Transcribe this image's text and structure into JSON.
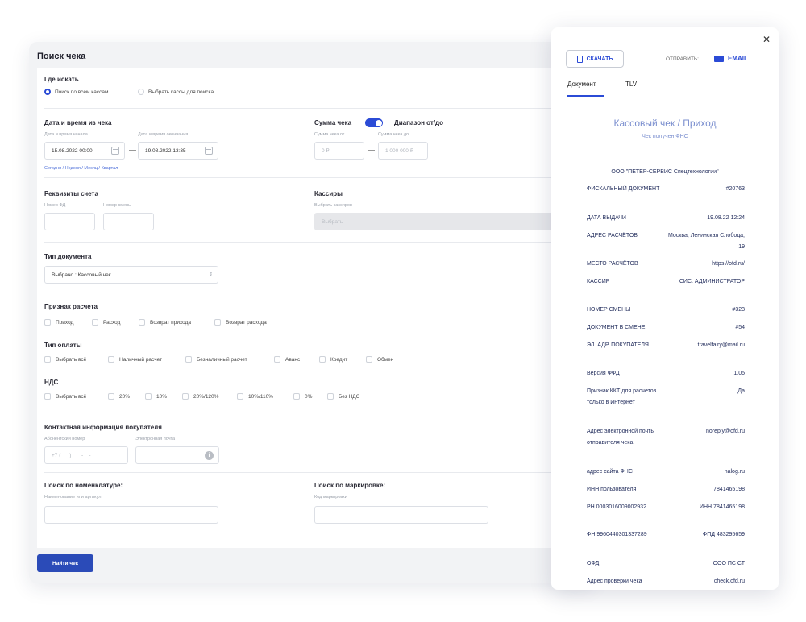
{
  "search": {
    "title": "Поиск чека",
    "where": {
      "title": "Где искать",
      "options": [
        "Поиск по всем кассам",
        "Выбрать кассы для поиска"
      ]
    },
    "datetime": {
      "title": "Дата и время из чека",
      "start_label": "Дата и время начала",
      "start_value": "15.08.2022 00:00",
      "end_label": "Дата и время окончания",
      "end_value": "19.08.2022 13:35",
      "quick_links": "Сегодня / Неделя / Месяц / Квартал"
    },
    "sum": {
      "title": "Сумма чека",
      "toggle_label": "Диапазон от/до",
      "from_label": "Сумма чека от",
      "from_value": "0 ₽",
      "to_label": "Сумма чека до",
      "to_value": "1 000 000 ₽"
    },
    "account": {
      "title": "Реквизиты счета",
      "fd_label": "Номер ФД",
      "shift_label": "Номер смены"
    },
    "cashiers": {
      "title": "Кассиры",
      "label": "Выбрать кассиров",
      "placeholder": "Выбрать"
    },
    "doc_type": {
      "title": "Тип документа",
      "value": "Выбрано : Кассовый чек"
    },
    "calc_sign": {
      "title": "Признак расчета",
      "options": [
        "Приход",
        "Расход",
        "Возврат прихода",
        "Возврат расхода"
      ]
    },
    "payment": {
      "title": "Тип оплаты",
      "options": [
        "Выбрать всё",
        "Наличный расчет",
        "Безналичный расчет",
        "Аванс",
        "Кредит",
        "Обмен"
      ]
    },
    "vat": {
      "title": "НДС",
      "options": [
        "Выбрать всё",
        "20%",
        "10%",
        "20%/120%",
        "10%/110%",
        "0%",
        "Без НДС"
      ]
    },
    "contact": {
      "title": "Контактная информация покупателя",
      "phone_label": "Абонентский номер",
      "phone_placeholder": "+7 (___) ___-__-__",
      "email_label": "Электронная почта"
    },
    "nomenclature": {
      "title": "Поиск по номенклатуре:",
      "label": "Наименование или артикул"
    },
    "marking": {
      "title": "Поиск по маркировке:",
      "label": "Код маркировки"
    },
    "find_button": "Найти чек"
  },
  "receipt": {
    "download": "СКАЧАТЬ",
    "send_label": "ОТПРАВИТЬ:",
    "email": "EMAIL",
    "tabs": [
      "Документ",
      "TLV"
    ],
    "title": "Кассовый чек / Приход",
    "subtitle": "Чек получен ФНС",
    "org": "ООО \"ПЕТЕР-СЕРВИС Спецтехнологии\"",
    "rows": [
      {
        "k": "ФИСКАЛЬНЫЙ ДОКУМЕНТ",
        "v": "#20763"
      },
      {
        "k": "ДАТА ВЫДАЧИ",
        "v": "19.08.22 12:24"
      },
      {
        "k": "АДРЕС РАСЧЁТОВ",
        "v": "Москва, Ленинская Слобода, 19"
      },
      {
        "k": "МЕСТО РАСЧЁТОВ",
        "v": "https://ofd.ru/"
      },
      {
        "k": "КАССИР",
        "v": "СИС. АДМИНИСТРАТОР"
      },
      {
        "k": "НОМЕР СМЕНЫ",
        "v": "#323"
      },
      {
        "k": "ДОКУМЕНТ В СМЕНЕ",
        "v": "#54"
      },
      {
        "k": "ЭЛ. АДР. ПОКУПАТЕЛЯ",
        "v": "travelfairy@mail.ru"
      },
      {
        "k": "Версия ФФД",
        "v": "1.05"
      },
      {
        "k": "Признак ККТ для расчетов только в Интернет",
        "v": "Да"
      },
      {
        "k": "Адрес электронной почты отправителя чека",
        "v": "noreply@ofd.ru"
      },
      {
        "k": "адрес сайта ФНС",
        "v": "nalog.ru"
      },
      {
        "k": "ИНН пользователя",
        "v": "7841465198"
      },
      {
        "k": "РН 0003016009002932",
        "v": "ИНН 7841465198"
      },
      {
        "k": "ФН 9960440301337289",
        "v": "ФПД 483295659"
      },
      {
        "k": "ОФД",
        "v": "ООО ПС СТ"
      },
      {
        "k": "Адрес проверки чека",
        "v": "check.ofd.ru"
      }
    ]
  }
}
